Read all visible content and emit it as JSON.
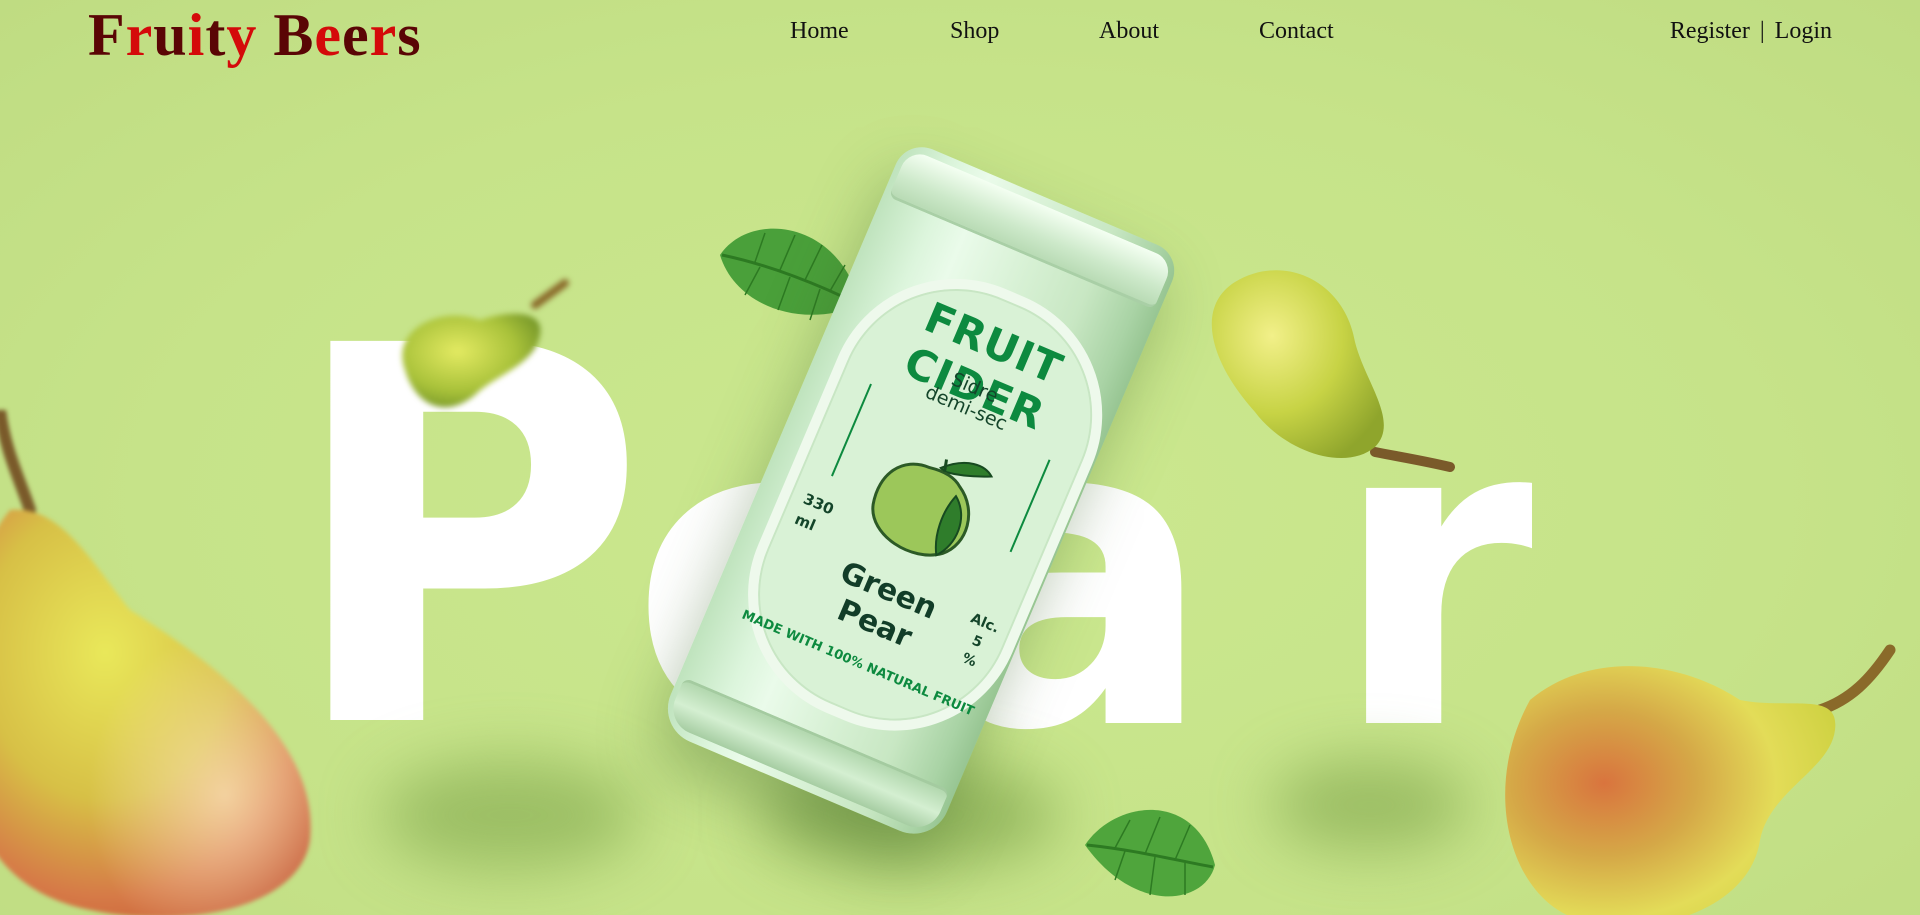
{
  "brand": {
    "letters": [
      {
        "ch": "F",
        "color": "#5a0505"
      },
      {
        "ch": "r",
        "color": "#d40a0a"
      },
      {
        "ch": "u",
        "color": "#5a0505"
      },
      {
        "ch": "i",
        "color": "#d40a0a"
      },
      {
        "ch": "t",
        "color": "#5a0505"
      },
      {
        "ch": "y",
        "color": "#d40a0a"
      },
      {
        "ch": " ",
        "color": "#5a0505"
      },
      {
        "ch": "B",
        "color": "#5a0505"
      },
      {
        "ch": "e",
        "color": "#d40a0a"
      },
      {
        "ch": "e",
        "color": "#5a0505"
      },
      {
        "ch": "r",
        "color": "#d40a0a"
      },
      {
        "ch": "s",
        "color": "#5a0505"
      }
    ]
  },
  "nav": {
    "home": "Home",
    "shop": "Shop",
    "about": "About",
    "contact": "Contact"
  },
  "auth": {
    "register": "Register",
    "separator": "|",
    "login": "Login"
  },
  "hero": {
    "word_letters": [
      "P",
      "e",
      "a",
      "r"
    ]
  },
  "can": {
    "title": "FRUIT CIDER",
    "subtitle_line1": "Sidre",
    "subtitle_line2": "demi-sec",
    "volume_line1": "330",
    "volume_line2": "ml",
    "name_line1": "Green",
    "name_line2": "Pear",
    "alc_line1": "Alc.",
    "alc_line2": "5",
    "alc_line3": "%",
    "bottom_text": "MADE WITH 100% NATURAL FRUIT"
  },
  "colors": {
    "background": "#c8e58c",
    "brand_dark": "#5a0505",
    "brand_red": "#d40a0a",
    "can_green": "#0d8a3f"
  }
}
